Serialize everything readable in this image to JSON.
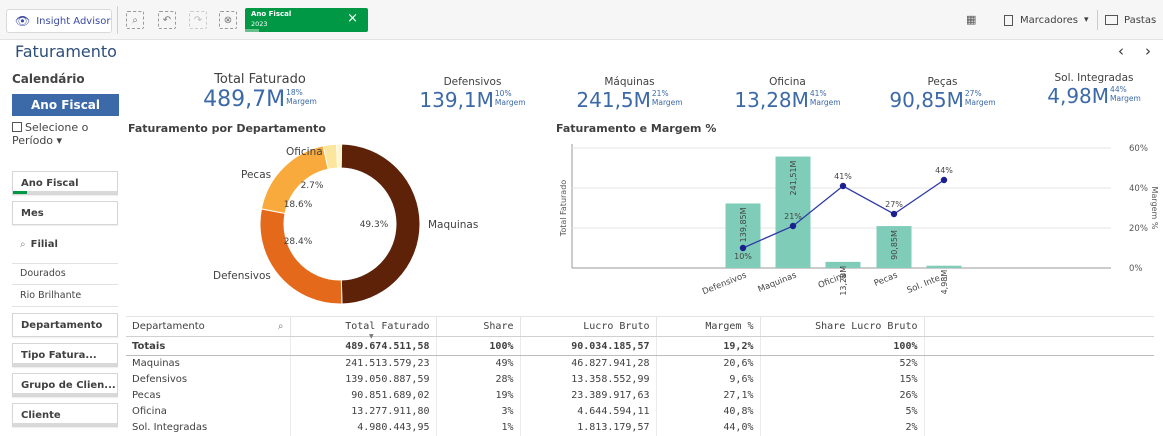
{
  "toolbar": {
    "insight_advisor": "Insight Advisor",
    "selection_field": "Ano Fiscal",
    "selection_value": "2023",
    "close": "×",
    "bookmarks": "Marcadores",
    "folders": "Pastas"
  },
  "page": {
    "title": "Faturamento",
    "prev": "‹",
    "next": "›"
  },
  "sidebar": {
    "calendar_title": "Calendário",
    "fiscal_year_button": "Ano Fiscal",
    "period_line1": "Selecione o",
    "period_line2": "Período",
    "filters": {
      "ano_fiscal": "Ano Fiscal",
      "mes": "Mes",
      "filial": "Filial",
      "filial_items": [
        "Dourados",
        "Rio Brilhante"
      ],
      "departamento": "Departamento",
      "tipo_faturamento": "Tipo Fatura...",
      "grupo_cliente": "Grupo de Clien...",
      "cliente": "Cliente"
    }
  },
  "kpis": [
    {
      "label": "Total Faturado",
      "value": "489,7M",
      "pct": "18%",
      "sub": "Margem"
    },
    {
      "label": "Defensivos",
      "value": "139,1M",
      "pct": "10%",
      "sub": "Margem"
    },
    {
      "label": "Máquinas",
      "value": "241,5M",
      "pct": "21%",
      "sub": "Margem"
    },
    {
      "label": "Oficina",
      "value": "13,28M",
      "pct": "41%",
      "sub": "Margem"
    },
    {
      "label": "Peças",
      "value": "90,85M",
      "pct": "27%",
      "sub": "Margem"
    },
    {
      "label": "Sol. Integradas",
      "value": "4,98M",
      "pct": "44%",
      "sub": "Margem"
    }
  ],
  "donut": {
    "title": "Faturamento por Departamento",
    "slices": [
      {
        "name": "Maquinas",
        "pct": 49.3,
        "label": "49.3%",
        "color": "#5e2209"
      },
      {
        "name": "Defensivos",
        "pct": 28.4,
        "label": "28.4%",
        "color": "#e5691a"
      },
      {
        "name": "Pecas",
        "pct": 18.6,
        "label": "18.6%",
        "color": "#f9aa3c"
      },
      {
        "name": "Oficina",
        "pct": 2.7,
        "label": "2.7%",
        "color": "#fce59c"
      },
      {
        "name": "Sol. Integradas",
        "pct": 1.0,
        "label": "",
        "color": "#fff4cc"
      }
    ]
  },
  "chart_data": {
    "type": "bar",
    "title": "Faturamento e Margem %",
    "categories": [
      "Defensivos",
      "Maquinas",
      "Oficina",
      "Pecas",
      "Sol. Inte..."
    ],
    "series": [
      {
        "name": "Total Faturado",
        "kind": "bar",
        "values": [
          139.85,
          241.51,
          13.28,
          90.85,
          4.98
        ],
        "labels": [
          "139,85M",
          "241,51M",
          "13,28M",
          "90,85M",
          "4,98M"
        ],
        "color": "#7fcdb8"
      },
      {
        "name": "Margem %",
        "kind": "line",
        "values": [
          10,
          21,
          41,
          27,
          44
        ],
        "labels": [
          "10%",
          "21%",
          "41%",
          "27%",
          "44%"
        ],
        "color": "#2e39a6"
      }
    ],
    "ylabel": "Total Faturado",
    "y2label": "Margem %",
    "y2ticks": [
      "60%",
      "40%",
      "20%",
      "0%"
    ],
    "ylim": [
      0,
      260
    ],
    "y2lim": [
      0,
      60
    ],
    "grid": true
  },
  "table": {
    "columns": [
      "Departamento",
      "Total Faturado",
      "Share",
      "Lucro Bruto",
      "Margem %",
      "Share Lucro Bruto"
    ],
    "totals": [
      "Totais",
      "489.674.511,58",
      "100%",
      "90.034.185,57",
      "19,2%",
      "100%"
    ],
    "rows": [
      [
        "Maquinas",
        "241.513.579,23",
        "49%",
        "46.827.941,28",
        "20,6%",
        "52%"
      ],
      [
        "Defensivos",
        "139.050.887,59",
        "28%",
        "13.358.552,99",
        "9,6%",
        "15%"
      ],
      [
        "Pecas",
        "90.851.689,02",
        "19%",
        "23.389.917,63",
        "27,1%",
        "26%"
      ],
      [
        "Oficina",
        "13.277.911,80",
        "3%",
        "4.644.594,11",
        "40,8%",
        "5%"
      ],
      [
        "Sol. Integradas",
        "4.980.443,95",
        "1%",
        "1.813.179,57",
        "44,0%",
        "2%"
      ]
    ]
  }
}
